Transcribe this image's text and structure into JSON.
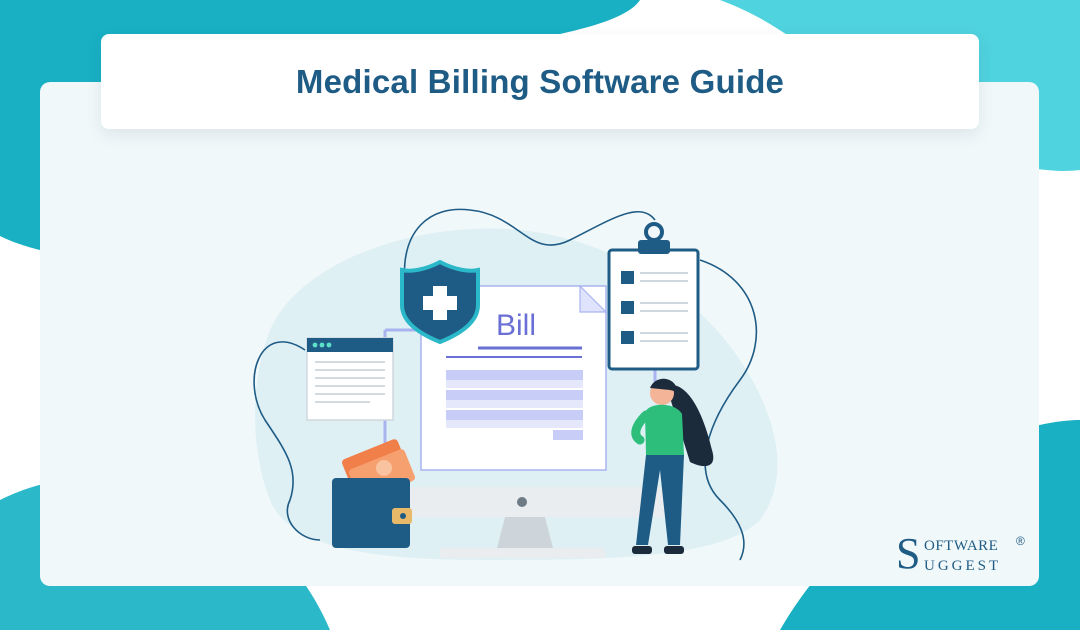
{
  "banner": {
    "title": "Medical Billing Software Guide"
  },
  "illustration": {
    "bill_label": "Bill",
    "icons": [
      "shield-plus-icon",
      "browser-window-icon",
      "clipboard-checklist-icon",
      "wallet-icon",
      "money-notes-icon",
      "monitor-icon",
      "woman-figure"
    ]
  },
  "logo": {
    "letter_top": "S",
    "text_top": "OFTWARE",
    "registered": "®",
    "letter_bottom": "S",
    "text_bottom": "UGGEST"
  },
  "colors": {
    "teal": "#2bb8c9",
    "navy": "#1f5c85",
    "panel": "#f1f8fa",
    "bill_purple": "#6a6fd6"
  }
}
